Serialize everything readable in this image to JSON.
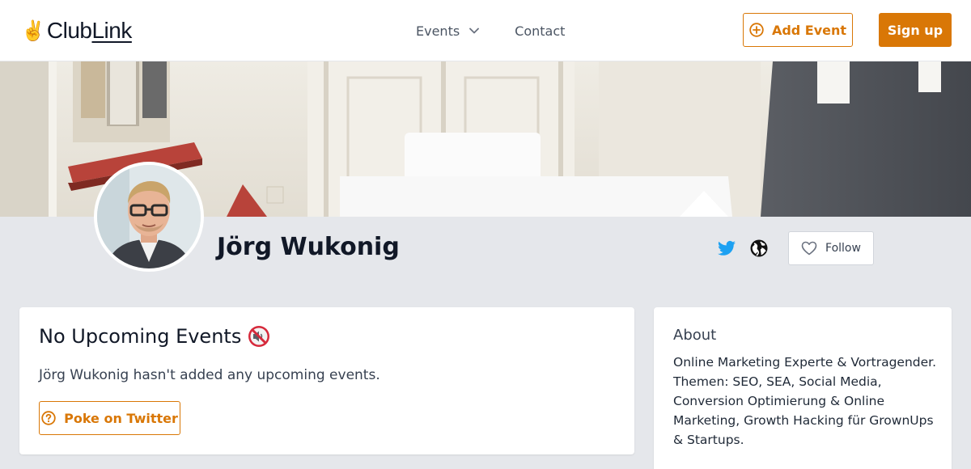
{
  "brand": {
    "name_prefix": "Club",
    "name_suffix": "Link",
    "accent_color": "#d97706"
  },
  "nav": {
    "events_label": "Events",
    "contact_label": "Contact",
    "add_event_label": "Add Event",
    "signup_label": "Sign up"
  },
  "profile": {
    "name": "Jörg Wukonig",
    "follow_label": "Follow",
    "social_icons": [
      "twitter-icon",
      "globe-icon"
    ]
  },
  "events_card": {
    "title": "No Upcoming Events",
    "empty_text": "Jörg Wukonig hasn't added any upcoming events.",
    "poke_label": "Poke on Twitter"
  },
  "about_card": {
    "title": "About",
    "text": "Online Marketing Experte & Vortragender. Themen: SEO, SEA, Social Media, Conversion Optimierung & Online Marketing, Growth Hacking für GrownUps & Startups."
  }
}
